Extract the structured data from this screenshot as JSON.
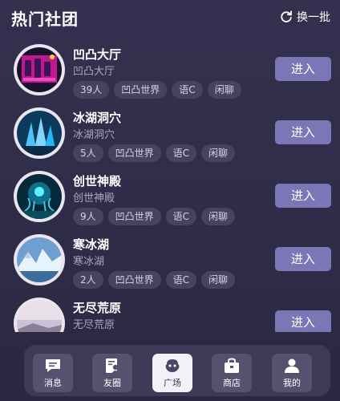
{
  "header": {
    "title": "热门社团",
    "refresh_label": "换一批"
  },
  "clubs": [
    {
      "name": "凹凸大厅",
      "subtitle": "凹凸大厅",
      "tags": [
        "39人",
        "凹凸世界",
        "语C",
        "闲聊"
      ],
      "join_label": "进入"
    },
    {
      "name": "冰湖洞穴",
      "subtitle": "冰湖洞穴",
      "tags": [
        "5人",
        "凹凸世界",
        "语C",
        "闲聊"
      ],
      "join_label": "进入"
    },
    {
      "name": "创世神殿",
      "subtitle": "创世神殿",
      "tags": [
        "9人",
        "凹凸世界",
        "语C",
        "闲聊"
      ],
      "join_label": "进入"
    },
    {
      "name": "寒冰湖",
      "subtitle": "寒冰湖",
      "tags": [
        "2人",
        "凹凸世界",
        "语C",
        "闲聊"
      ],
      "join_label": "进入"
    },
    {
      "name": "无尽荒原",
      "subtitle": "无尽荒原",
      "tags": [],
      "join_label": "进入"
    }
  ],
  "nav": [
    {
      "label": "消息",
      "icon": "message-icon"
    },
    {
      "label": "友圈",
      "icon": "friends-circle-icon"
    },
    {
      "label": "广场",
      "icon": "plaza-icon",
      "active": true
    },
    {
      "label": "商店",
      "icon": "shop-icon"
    },
    {
      "label": "我的",
      "icon": "profile-icon"
    }
  ]
}
